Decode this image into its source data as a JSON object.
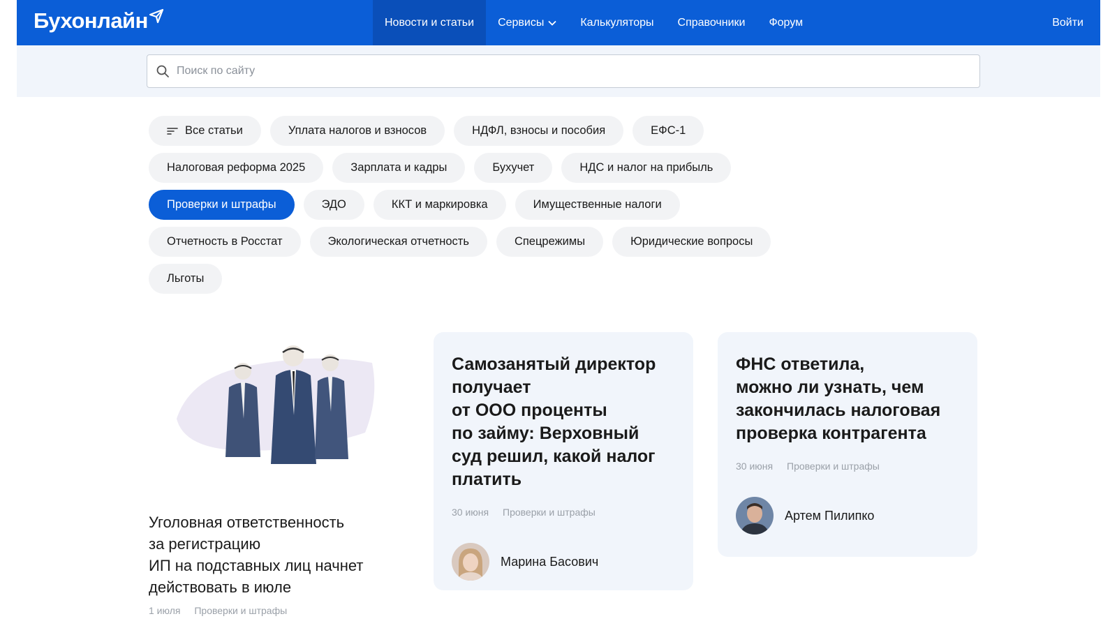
{
  "header": {
    "logo_text": "Бухонлайн",
    "nav": [
      {
        "label": "Новости и статьи",
        "active": true
      },
      {
        "label": "Сервисы",
        "has_dropdown": true
      },
      {
        "label": "Калькуляторы"
      },
      {
        "label": "Справочники"
      },
      {
        "label": "Форум"
      }
    ],
    "login_label": "Войти",
    "accent_color": "#0b5ed7"
  },
  "search": {
    "placeholder": "Поиск по сайту",
    "value": ""
  },
  "categories": {
    "rows": [
      [
        "Все статьи",
        "Уплата налогов и взносов",
        "НДФЛ, взносы и пособия",
        "ЕФС-1"
      ],
      [
        "Налоговая реформа 2025",
        "Зарплата и кадры",
        "Бухучет",
        "НДС и налог на прибыль"
      ],
      [
        "Проверки и штрафы",
        "ЭДО",
        "ККТ и маркировка",
        "Имущественные налоги"
      ],
      [
        "Отчетность в Росстат",
        "Экологическая отчетность",
        "Спецрежимы",
        "Юридические вопросы"
      ],
      [
        "Льготы"
      ]
    ],
    "active": "Проверки и штрафы"
  },
  "articles": [
    {
      "title_lines": [
        "Уголовная ответственность",
        "за регистрацию",
        "ИП на подставных лиц начнет",
        "действовать в июле"
      ],
      "date": "1 июля",
      "category": "Проверки и штрафы",
      "image_icon": "masked-businessmen-illustration"
    },
    {
      "title_lines": [
        "Самозанятый директор",
        "получает",
        "от ООО проценты",
        "по займу: Верховный",
        "суд решил, какой налог",
        "платить"
      ],
      "date": "30 июня",
      "category": "Проверки и штрафы",
      "author": "Марина Басович"
    },
    {
      "title_lines": [
        "ФНС ответила,",
        "можно ли узнать, чем",
        "закончилась налоговая",
        "проверка контрагента"
      ],
      "date": "30 июня",
      "category": "Проверки и штрафы",
      "author": "Артем Пилипко"
    }
  ]
}
